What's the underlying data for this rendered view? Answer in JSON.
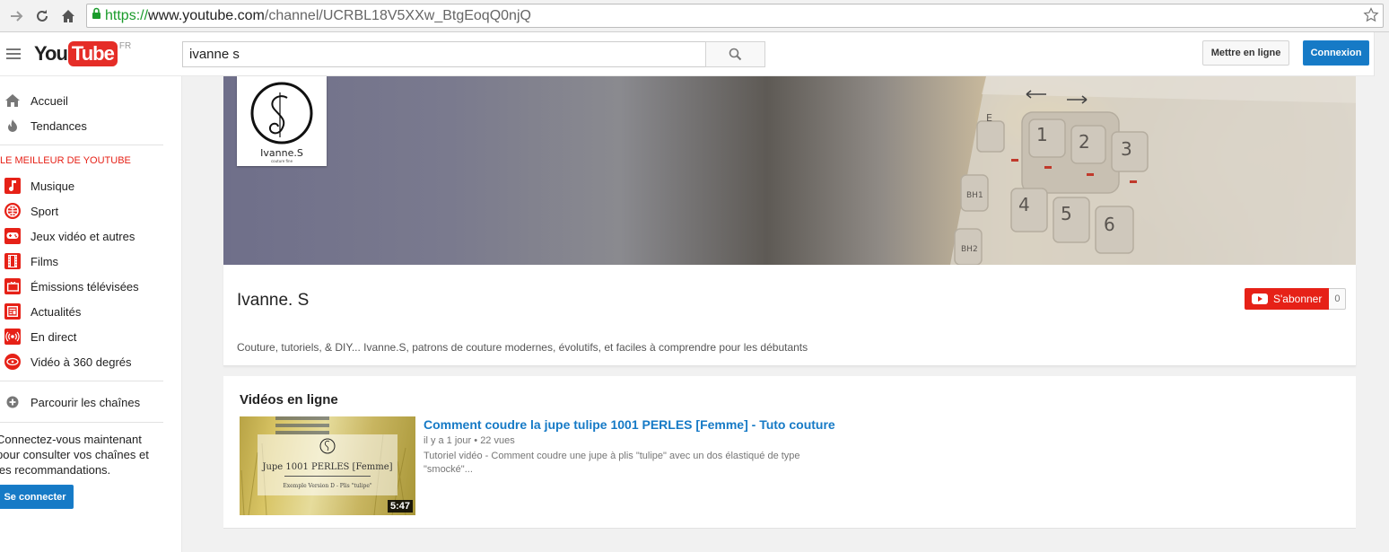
{
  "browser": {
    "url_scheme": "https://",
    "url_host": "www.youtube.com",
    "url_path": "/channel/UCRBL18V5XXw_BtgEoqQ0njQ"
  },
  "masthead": {
    "logo_you": "You",
    "logo_tube": "Tube",
    "logo_region": "FR",
    "search_value": "ivanne s",
    "upload_label": "Mettre en ligne",
    "login_label": "Connexion"
  },
  "sidebar": {
    "top_items": [
      {
        "label": "Accueil",
        "icon": "home-icon"
      },
      {
        "label": "Tendances",
        "icon": "flame-icon"
      }
    ],
    "best_heading": "LE MEILLEUR DE YOUTUBE",
    "best_items": [
      {
        "label": "Musique",
        "icon": "music-icon"
      },
      {
        "label": "Sport",
        "icon": "sport-icon"
      },
      {
        "label": "Jeux vidéo et autres",
        "icon": "gamepad-icon"
      },
      {
        "label": "Films",
        "icon": "film-icon"
      },
      {
        "label": "Émissions télévisées",
        "icon": "tv-icon"
      },
      {
        "label": "Actualités",
        "icon": "news-icon"
      },
      {
        "label": "En direct",
        "icon": "live-icon"
      },
      {
        "label": "Vidéo à 360 degrés",
        "icon": "360-icon"
      }
    ],
    "browse_label": "Parcourir les chaînes",
    "promo_text": "Connectez-vous maintenant pour consulter vos chaînes et les recommandations.",
    "signin_label": "Se connecter"
  },
  "channel": {
    "avatar_name": "Ivanne.S",
    "avatar_tagline": "couture fine",
    "title": "Ivanne. S",
    "subscribe_label": "S'abonner",
    "subscriber_count": "0",
    "description": "Couture, tutoriels, & DIY... Ivanne.S, patrons de couture modernes, évolutifs, et faciles à comprendre pour les débutants"
  },
  "videos": {
    "section_title": "Vidéos en ligne",
    "items": [
      {
        "title": "Comment coudre la jupe tulipe 1001 PERLES [Femme] - Tuto couture",
        "age": "il y a 1 jour",
        "views": "22 vues",
        "description": "Tutoriel vidéo - Comment coudre une jupe à plis \"tulipe\" avec un dos élastiqué de type \"smocké\"...",
        "duration": "5:47",
        "thumb_title": "Jupe 1001 PERLES [Femme]",
        "thumb_subtitle": "Exemple Version D - Plis \"tulipe\""
      }
    ]
  },
  "colors": {
    "youtube_red": "#e62117",
    "link_blue": "#167ac6"
  }
}
